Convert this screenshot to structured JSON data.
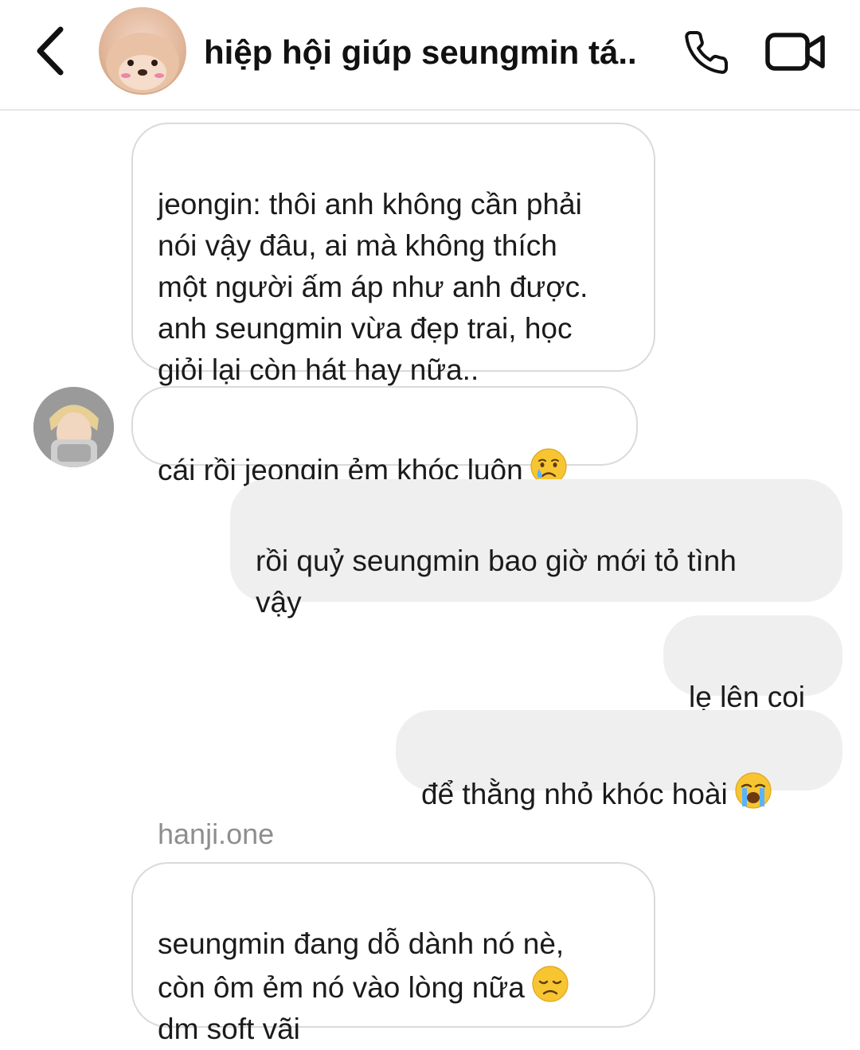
{
  "header": {
    "title": "hiệp hội giúp seungmin tá..",
    "back_icon": "chevron-left-icon",
    "call_icon": "phone-icon",
    "video_icon": "video-camera-icon"
  },
  "messages": [
    {
      "direction": "incoming",
      "text": "jeongin: thôi anh không cần phải\nnói vậy đâu, ai mà không thích\nmột người ấm áp như anh được.\nanh seungmin vừa đẹp trai, học\ngiỏi lại còn hát hay nữa.."
    },
    {
      "direction": "incoming",
      "text": "cái rồi jeongin ẻm khóc luôn",
      "emoji": "crying-face"
    },
    {
      "direction": "outgoing",
      "text": "rồi quỷ seungmin bao giờ mới tỏ tình\nvậy"
    },
    {
      "direction": "outgoing",
      "text": "lẹ lên coi"
    },
    {
      "direction": "outgoing",
      "text": "để thằng nhỏ khóc hoài",
      "emoji": "loudly-crying-face"
    },
    {
      "direction": "incoming",
      "sender": "hanji.one",
      "text": "seungmin đang dỗ dành nó nè,\ncòn ôm ẻm nó vào lòng nữa",
      "emoji": "disappointed-face",
      "text_after": "dm soft vãi"
    }
  ],
  "colors": {
    "outgoing_bubble": "#efefef",
    "incoming_border": "#dadada",
    "sender_name": "#8e8e8e",
    "divider": "#e6e6e6"
  }
}
